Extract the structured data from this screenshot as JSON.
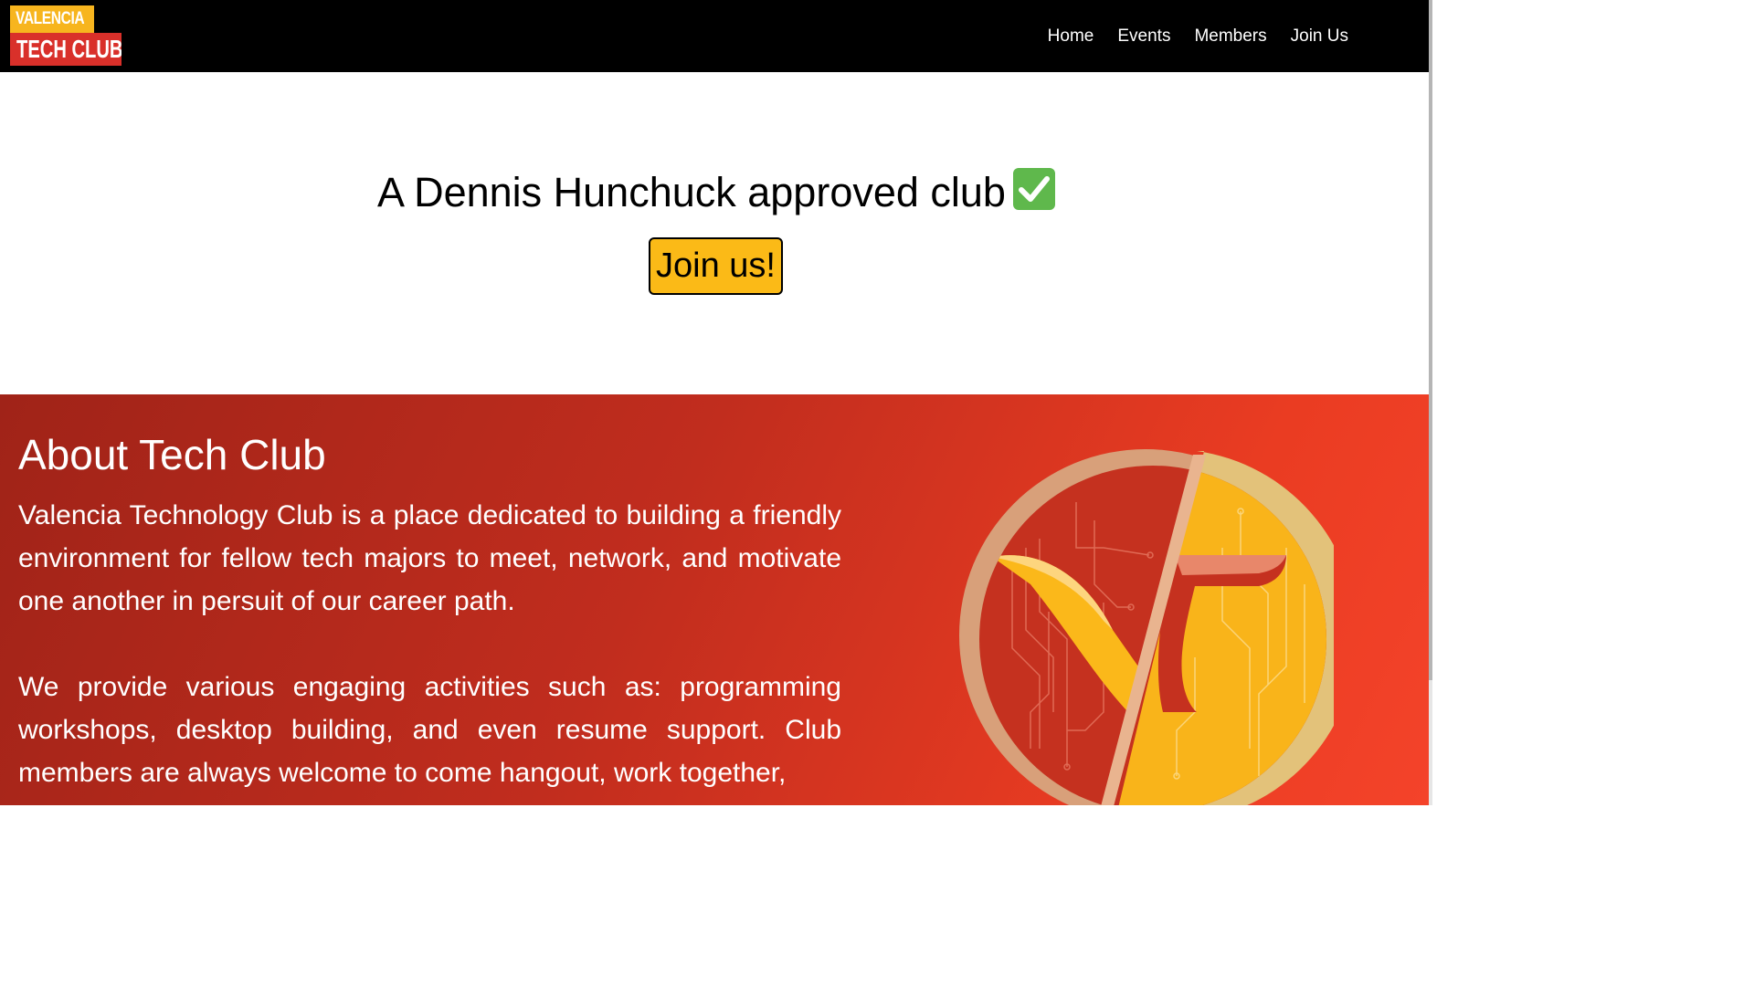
{
  "navbar": {
    "logo": {
      "top_text": "VALENCIA",
      "bottom_text": "TECH CLUB"
    },
    "links": [
      "Home",
      "Events",
      "Members",
      "Join Us"
    ]
  },
  "hero": {
    "title": "A Dennis Hunchuck approved club",
    "check_icon": "check-mark-button-icon",
    "join_label": "Join us!"
  },
  "about": {
    "title": "About Tech Club",
    "paragraph1": "Valencia Technology Club is a place dedicated to building a friendly environment for fellow tech majors to meet, network, and motivate one another in persuit of our career path.",
    "paragraph2": "We provide various engaging activities such as: programming workshops, desktop building, and even resume support. Club members are always welcome to come hangout, work together,",
    "emblem_icon": "valencia-v-emblem-icon"
  },
  "colors": {
    "navbar_bg": "#000000",
    "accent_yellow": "#fbba17",
    "accent_red": "#d9302a",
    "about_gradient_start": "#a02318",
    "about_gradient_end": "#f4432a"
  }
}
